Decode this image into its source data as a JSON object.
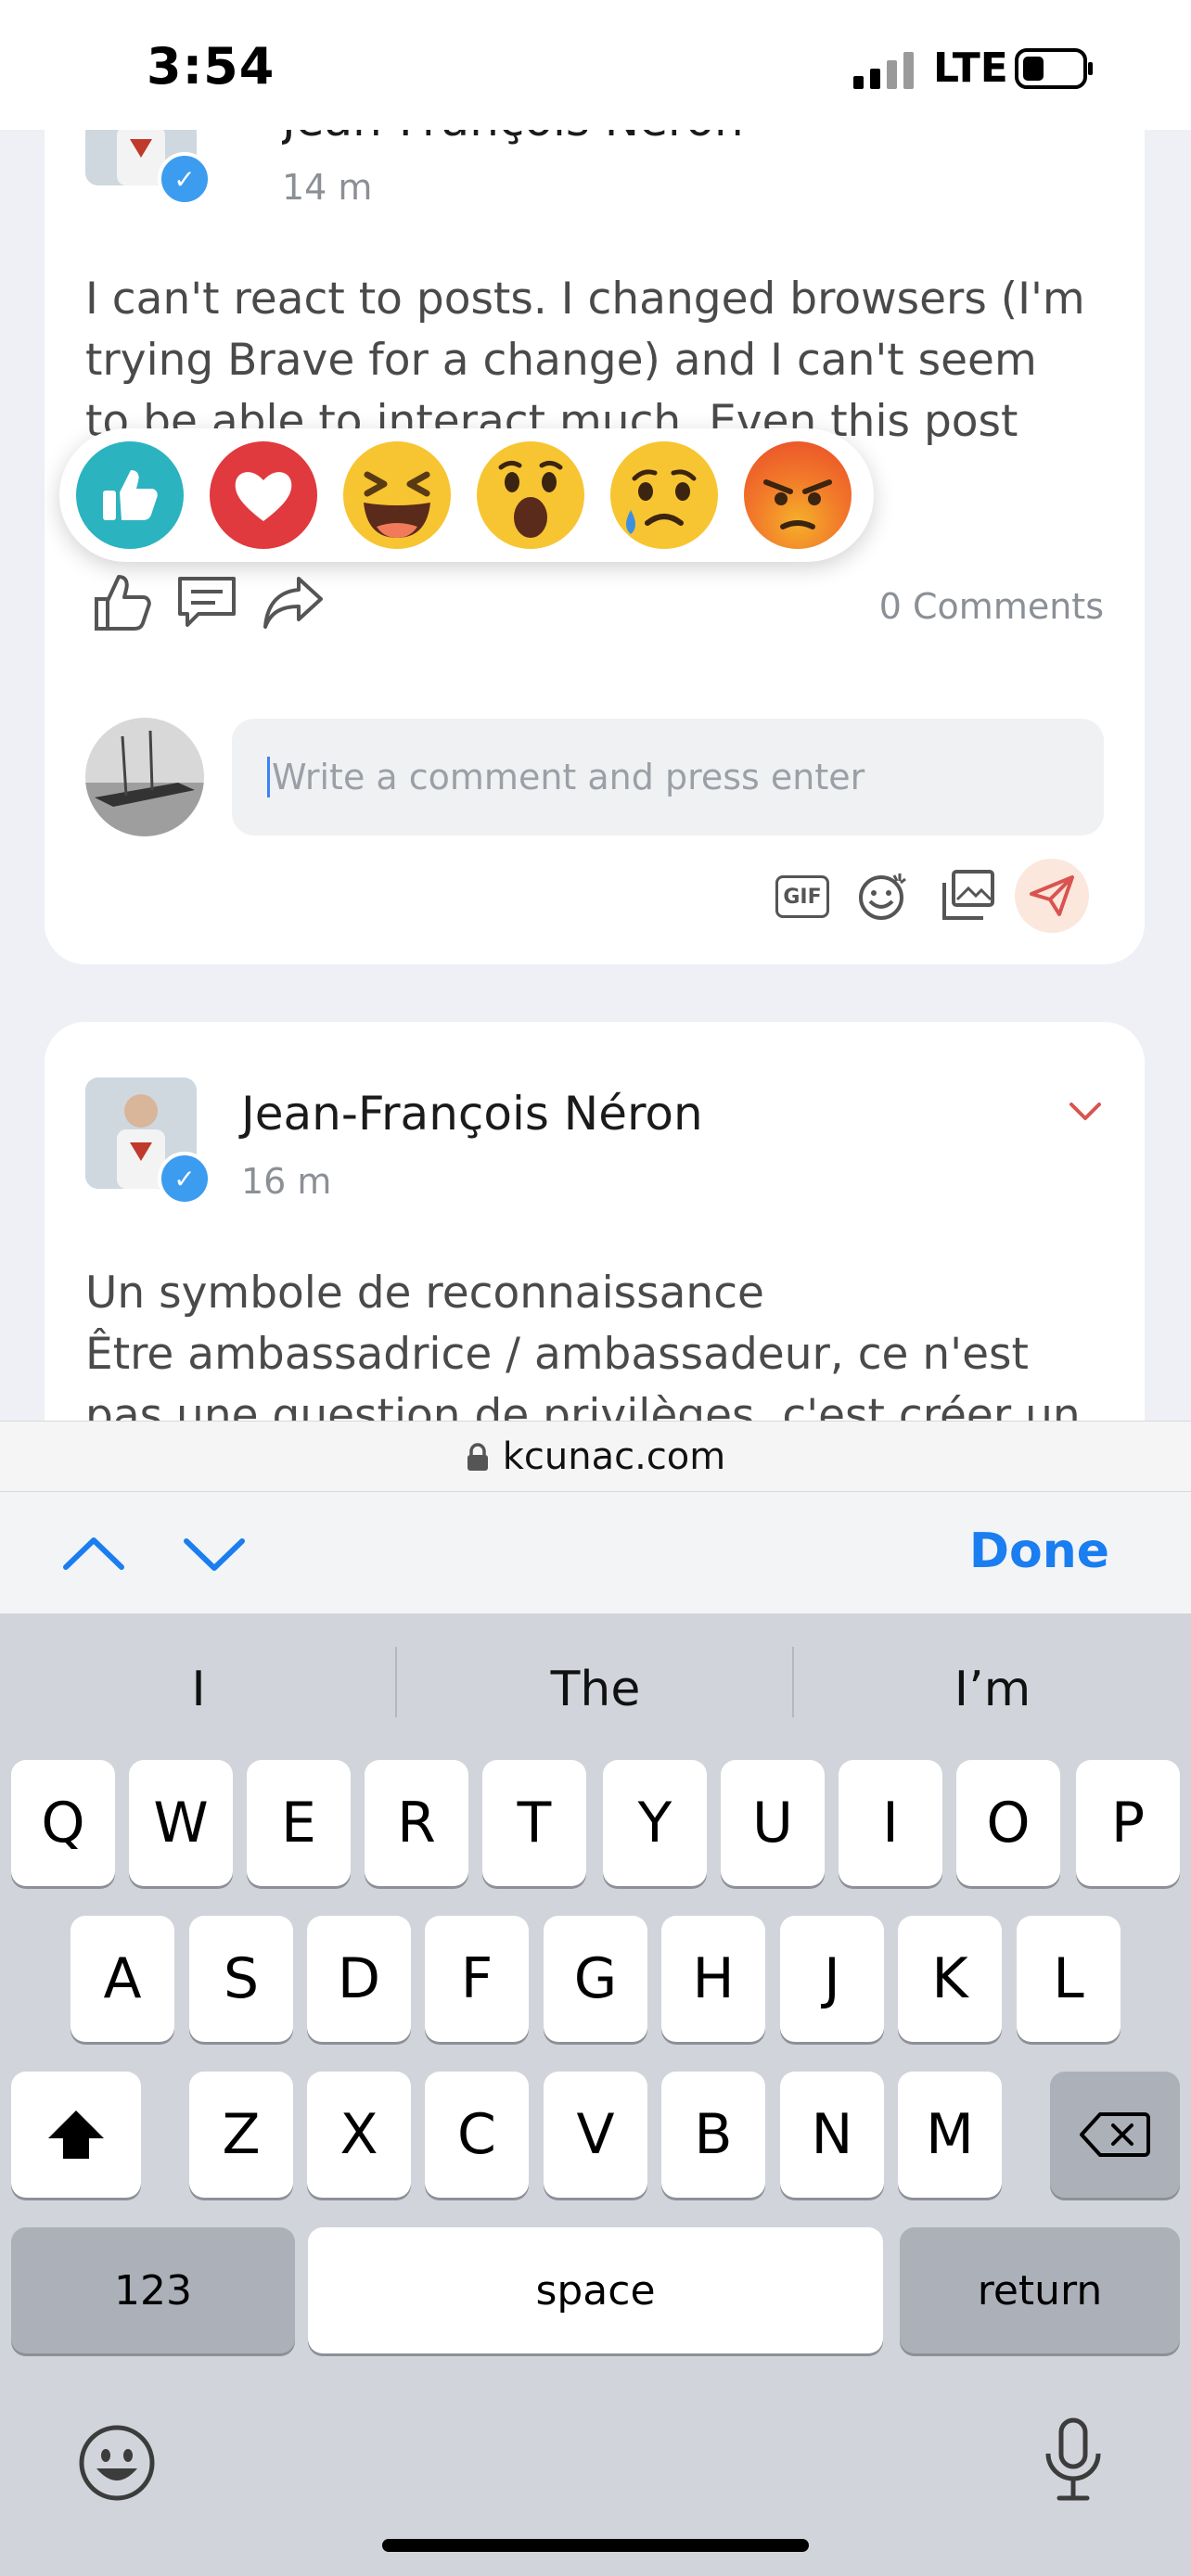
{
  "status_bar": {
    "time": "3:54",
    "network": "LTE"
  },
  "post1": {
    "author": "Jean-François Néron",
    "time_ago": "14 m",
    "text_lines": [
      "I can't react to posts. I changed browsers (I'm",
      "trying Brave for a change) and I can't seem",
      "to be able to interact much. Even this post"
    ],
    "comments_label": "0 Comments",
    "comment_placeholder": "Write a comment and press enter",
    "gif_label": "GIF"
  },
  "reactions": [
    "like",
    "love",
    "haha",
    "wow",
    "sad",
    "angry"
  ],
  "post2": {
    "author": "Jean-François Néron",
    "time_ago": "16 m",
    "text_lines": [
      "Un symbole de reconnaissance",
      "Être ambassadrice / ambassadeur, ce n'est",
      "pas une question de privilèges, c'est créer un"
    ]
  },
  "browser": {
    "url": "kcunac.com",
    "done_label": "Done"
  },
  "keyboard": {
    "suggestions": [
      "I",
      "The",
      "I’m"
    ],
    "row1": [
      "Q",
      "W",
      "E",
      "R",
      "T",
      "Y",
      "U",
      "I",
      "O",
      "P"
    ],
    "row2": [
      "A",
      "S",
      "D",
      "F",
      "G",
      "H",
      "J",
      "K",
      "L"
    ],
    "row3": [
      "Z",
      "X",
      "C",
      "V",
      "B",
      "N",
      "M"
    ],
    "numbers_label": "123",
    "space_label": "space",
    "return_label": "return"
  },
  "colors": {
    "accent_blue": "#1a7df0",
    "like_teal": "#2bb3c0",
    "love_red": "#e0393e",
    "send_bg": "#fbe7dc"
  }
}
